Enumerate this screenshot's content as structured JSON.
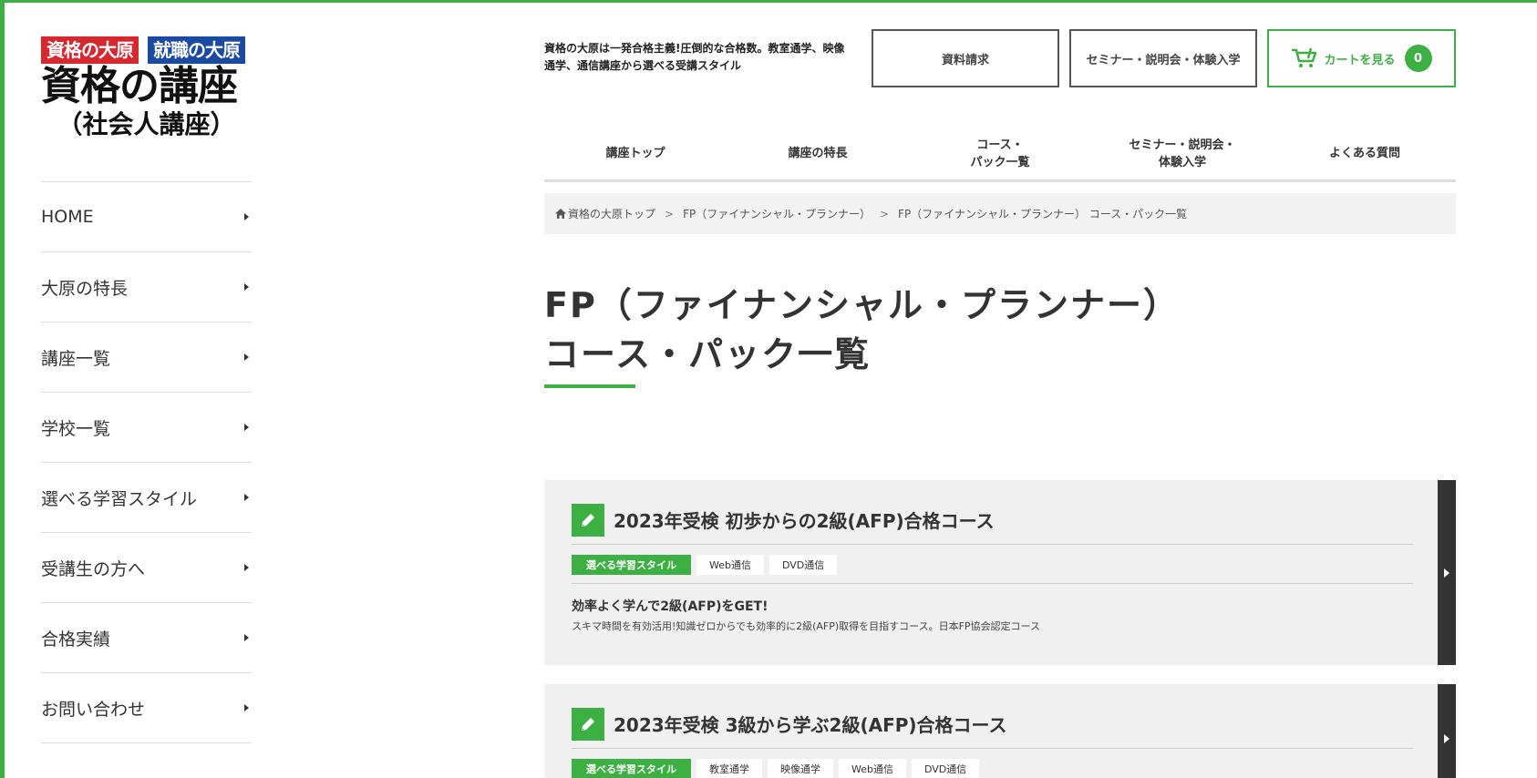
{
  "colors": {
    "accent": "#3cb043",
    "dark": "#333333",
    "badge_red": "#d7282f",
    "badge_blue": "#1b4aa3"
  },
  "logo": {
    "badge1": "資格の大原",
    "badge2": "就職の大原",
    "main": "資格の講座",
    "sub": "（社会人講座）"
  },
  "sidebar": {
    "items": [
      {
        "label": "HOME"
      },
      {
        "label": "大原の特長"
      },
      {
        "label": "講座一覧"
      },
      {
        "label": "学校一覧"
      },
      {
        "label": "選べる学習スタイル"
      },
      {
        "label": "受講生の方へ"
      },
      {
        "label": "合格実績"
      },
      {
        "label": "お問い合わせ"
      }
    ]
  },
  "header": {
    "tagline": "資格の大原は一発合格主義!圧倒的な合格数。教室通学、映像通学、通信講座から選べる受講スタイル",
    "doc_button": "資料請求",
    "seminar_button": "セミナー・説明会・体験入学",
    "cart_button": "カートを見る",
    "cart_count": "0"
  },
  "gnav": {
    "items": [
      {
        "label": "講座トップ"
      },
      {
        "label": "講座の特長"
      },
      {
        "label": "コース・\nパック一覧"
      },
      {
        "label": "セミナー・説明会・\n体験入学"
      },
      {
        "label": "よくある質問"
      }
    ]
  },
  "breadcrumb": {
    "home": "資格の大原トップ",
    "level2": "FP（ファイナンシャル・プランナー）",
    "current": "FP（ファイナンシャル・プランナー） コース・パック一覧",
    "separator": ">"
  },
  "page": {
    "title_line1": "FP（ファイナンシャル・プランナー）",
    "title_line2": "コース・パック一覧"
  },
  "courses": [
    {
      "title": "2023年受検 初歩からの2級(AFP)合格コース",
      "style_label": "選べる学習スタイル",
      "tags": [
        "Web通信",
        "DVD通信"
      ],
      "lead": "効率よく学んで2級(AFP)をGET!",
      "desc": "スキマ時間を有効活用!知識ゼロからでも効率的に2級(AFP)取得を目指すコース。日本FP協会認定コース"
    },
    {
      "title": "2023年受検 3級から学ぶ2級(AFP)合格コース",
      "style_label": "選べる学習スタイル",
      "tags": [
        "教室通学",
        "映像通学",
        "Web通信",
        "DVD通信"
      ]
    }
  ]
}
